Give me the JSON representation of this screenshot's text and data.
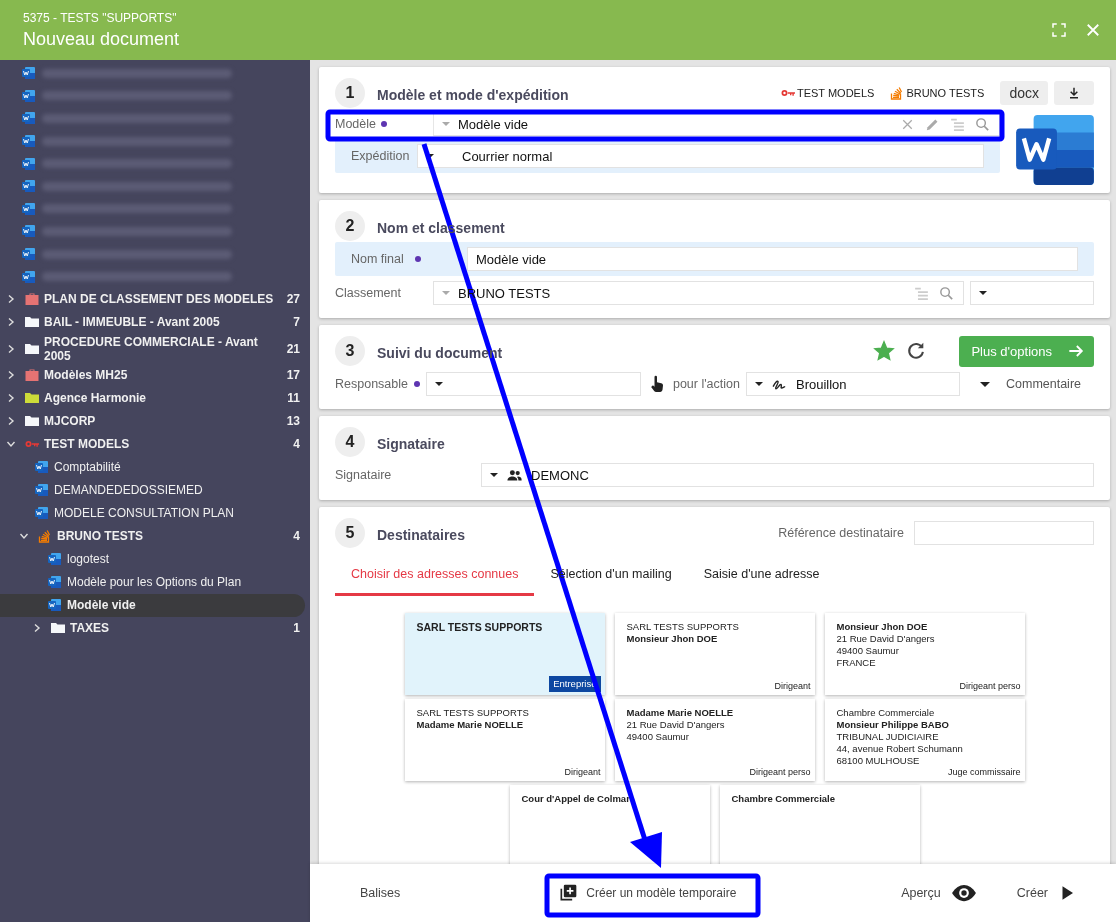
{
  "window": {
    "subtitle": "5375 - TESTS \"SUPPORTS\"",
    "title": "Nouveau document"
  },
  "sidebar": {
    "items": [
      {
        "kind": "blurred"
      },
      {
        "kind": "blurred"
      },
      {
        "kind": "blurred"
      },
      {
        "kind": "blurred"
      },
      {
        "kind": "blurred"
      },
      {
        "kind": "blurred"
      },
      {
        "kind": "blurred"
      },
      {
        "kind": "blurred"
      },
      {
        "kind": "blurred"
      },
      {
        "kind": "blurred"
      },
      {
        "kind": "briefcase",
        "color": "#e57373",
        "label": "PLAN DE CLASSEMENT DES MODELES",
        "count": "27",
        "expanded": false,
        "selected": false
      },
      {
        "kind": "folder",
        "color": "#f5f7fa",
        "label": "BAIL - IMMEUBLE - Avant 2005",
        "count": "7",
        "expanded": false,
        "selected": false
      },
      {
        "kind": "folder",
        "color": "#f5f7fa",
        "label": "PROCEDURE COMMERCIALE - Avant 2005",
        "count": "21",
        "expanded": false,
        "selected": false
      },
      {
        "kind": "briefcase",
        "color": "#e57373",
        "label": "Modèles MH25",
        "count": "17",
        "expanded": false,
        "selected": false
      },
      {
        "kind": "folder",
        "color": "#cddc39",
        "label": "Agence Harmonie",
        "count": "11",
        "expanded": false,
        "selected": false
      },
      {
        "kind": "folder",
        "color": "#f5f7fa",
        "label": "MJCORP",
        "count": "13",
        "expanded": false,
        "selected": false
      },
      {
        "kind": "key",
        "color": "#e53935",
        "label": "TEST MODELS",
        "count": "4",
        "expanded": true,
        "selected": false,
        "children": [
          {
            "kind": "word",
            "label": "Comptabilité",
            "selected": false
          },
          {
            "kind": "word",
            "label": "DEMANDEDEDOSSIEMED",
            "selected": false
          },
          {
            "kind": "word",
            "label": "MODELE CONSULTATION PLAN",
            "selected": false
          },
          {
            "kind": "stack",
            "color": "#f57c00",
            "label": "BRUNO TESTS",
            "count": "4",
            "expanded": true,
            "selected": false,
            "children": [
              {
                "kind": "word",
                "label": "logotest",
                "selected": false
              },
              {
                "kind": "word",
                "label": "Modèle pour les Options du Plan",
                "selected": false
              },
              {
                "kind": "word",
                "label": "Modèle vide",
                "selected": true
              },
              {
                "kind": "folder",
                "color": "#f5f7fa",
                "label": "TAXES",
                "count": "1",
                "expanded": false,
                "selected": false
              }
            ]
          }
        ]
      }
    ]
  },
  "model_section": {
    "number": "1",
    "title": "Modèle et mode d'expédition",
    "tags": [
      {
        "kind": "key",
        "label": "TEST MODELS"
      },
      {
        "kind": "stack",
        "label": "BRUNO TESTS"
      }
    ],
    "format": "docx",
    "model_field": {
      "label": "Modèle",
      "value": "Modèle vide"
    },
    "shipping_field": {
      "label": "Expédition",
      "value": "Courrier normal"
    }
  },
  "naming_section": {
    "number": "2",
    "title": "Nom et classement",
    "name_field": {
      "label": "Nom final",
      "value": "Modèle vide"
    },
    "filing_field": {
      "label": "Classement",
      "value": "BRUNO TESTS"
    }
  },
  "tracking_section": {
    "number": "3",
    "title": "Suivi du document",
    "favorite": true,
    "options_button": "Plus d'options",
    "responsible_label": "Responsable",
    "action_label": "pour l'action",
    "action_value": "Brouillon",
    "comment_label": "Commentaire"
  },
  "signatory_section": {
    "number": "4",
    "title": "Signataire",
    "field": {
      "label": "Signataire",
      "value": "DEMONC"
    }
  },
  "recipients_section": {
    "number": "5",
    "title": "Destinataires",
    "reference_label": "Référence destinataire",
    "tabs": [
      {
        "label": "Choisir des adresses connues",
        "selected": true
      },
      {
        "label": "Sélection d'un mailing",
        "selected": false
      },
      {
        "label": "Saisie d'une adresse",
        "selected": false
      }
    ],
    "cards": [
      {
        "lines": [
          {
            "text": "SARL TESTS SUPPORTS",
            "bold": true
          }
        ],
        "role": "Entreprise",
        "selected": true
      },
      {
        "lines": [
          {
            "text": "SARL TESTS SUPPORTS",
            "bold": false
          },
          {
            "text": "Monsieur Jhon DOE",
            "bold": true
          }
        ],
        "role": "Dirigeant",
        "selected": false
      },
      {
        "lines": [
          {
            "text": "Monsieur Jhon DOE",
            "bold": true
          },
          {
            "text": "21 Rue David D'angers",
            "bold": false
          },
          {
            "text": "49400 Saumur",
            "bold": false
          },
          {
            "text": "FRANCE",
            "bold": false
          }
        ],
        "role": "Dirigeant perso",
        "selected": false
      },
      {
        "lines": [
          {
            "text": "SARL TESTS SUPPORTS",
            "bold": false
          },
          {
            "text": "Madame Marie NOELLE",
            "bold": true
          }
        ],
        "role": "Dirigeant",
        "selected": false
      },
      {
        "lines": [
          {
            "text": "Madame Marie NOELLE",
            "bold": true
          },
          {
            "text": "21 Rue David D'angers",
            "bold": false
          },
          {
            "text": "49400 Saumur",
            "bold": false
          }
        ],
        "role": "Dirigeant perso",
        "selected": false
      },
      {
        "lines": [
          {
            "text": "Chambre Commerciale",
            "bold": false
          },
          {
            "text": "Monsieur Philippe BABO",
            "bold": true
          },
          {
            "text": "TRIBUNAL JUDICIAIRE",
            "bold": false
          },
          {
            "text": "44, avenue Robert Schumann",
            "bold": false
          },
          {
            "text": "68100 MULHOUSE",
            "bold": false
          }
        ],
        "role": "Juge commissaire",
        "selected": false
      },
      {
        "lines": [
          {
            "text": "Cour d'Appel de Colmar",
            "bold": true
          }
        ],
        "selected": false
      },
      {
        "lines": [
          {
            "text": "Chambre Commerciale",
            "bold": true
          }
        ],
        "selected": false
      }
    ]
  },
  "footer": {
    "buttons": [
      {
        "kind": "tags",
        "label": "Balises"
      },
      {
        "kind": "add",
        "label": "Créer un modèle temporaire"
      },
      {
        "kind": "preview",
        "label": "Aperçu"
      },
      {
        "kind": "create",
        "label": "Créer"
      }
    ]
  }
}
